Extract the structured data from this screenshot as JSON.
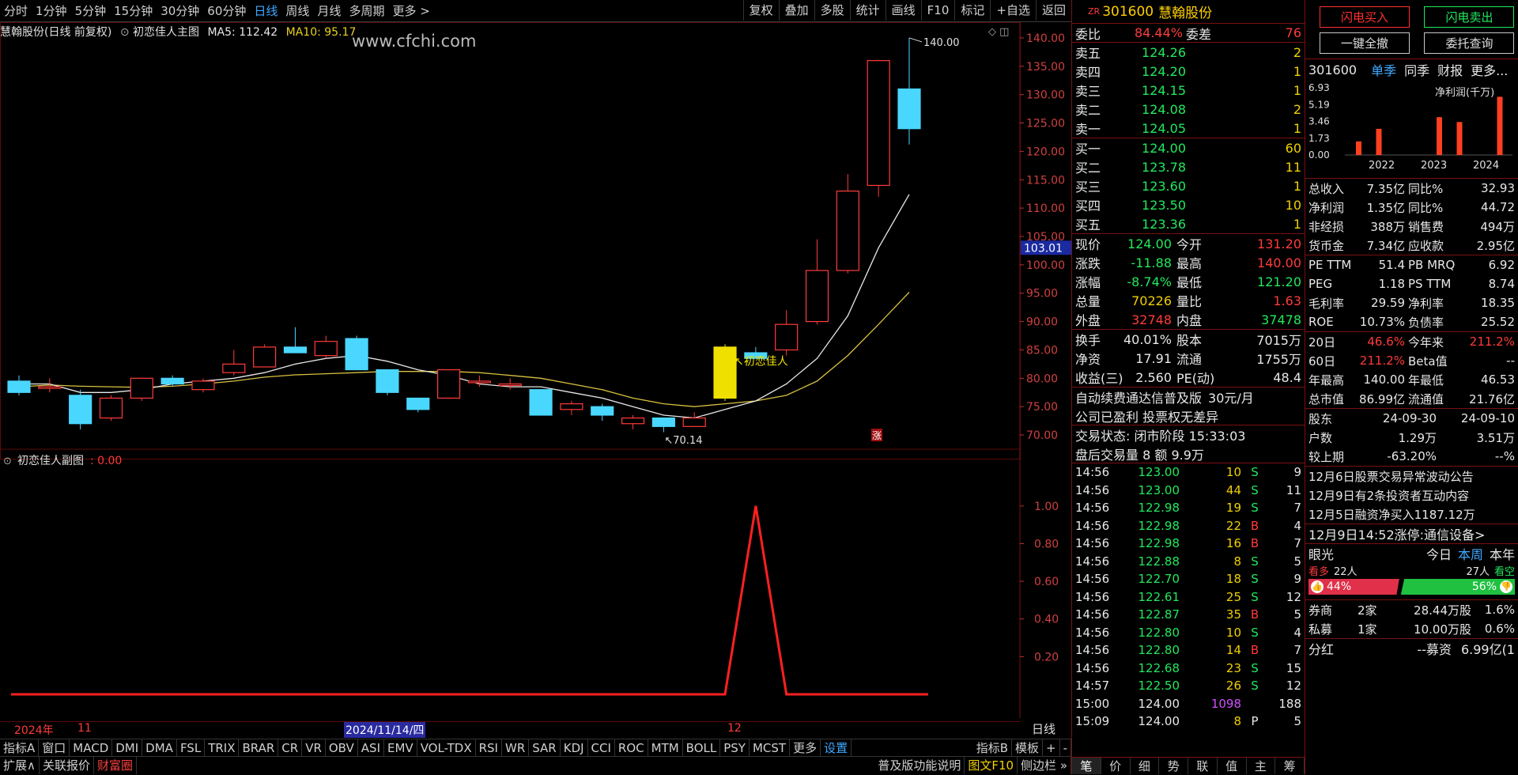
{
  "toolbar": {
    "periods": [
      "分时",
      "1分钟",
      "5分钟",
      "15分钟",
      "30分钟",
      "60分钟",
      "日线",
      "周线",
      "月线",
      "多周期",
      "更多 >"
    ],
    "active": "日线",
    "right": [
      "复权",
      "叠加",
      "多股",
      "统计",
      "画线",
      "F10",
      "标记",
      "+自选",
      "返回"
    ]
  },
  "chart_head": {
    "stock": "慧翰股份(日线 前复权)",
    "indicator": "初恋佳人主图",
    "ma5_label": "MA5: 112.42",
    "ma10_label": "MA10: 95.17"
  },
  "watermark": "www.cfchi.com",
  "main_axis": {
    "ticks": [
      "140.00",
      "135.00",
      "130.00",
      "125.00",
      "120.00",
      "115.00",
      "110.00",
      "105.00",
      "100.00",
      "95.00",
      "90.00",
      "85.00",
      "80.00",
      "75.00",
      "70.00"
    ],
    "current": "103.01"
  },
  "chart_data": [
    {
      "type": "candlestick",
      "ylim": [
        67.5,
        142.5
      ],
      "candles": [
        {
          "o": 79.5,
          "h": 80.5,
          "l": 77,
          "c": 77.5
        },
        {
          "o": 78.5,
          "h": 80,
          "l": 77.5,
          "c": 78.5
        },
        {
          "o": 77,
          "h": 78,
          "l": 71,
          "c": 72
        },
        {
          "o": 73,
          "h": 77,
          "l": 72.5,
          "c": 76.5
        },
        {
          "o": 76.5,
          "h": 80,
          "l": 76,
          "c": 80
        },
        {
          "o": 80,
          "h": 80.5,
          "l": 78.5,
          "c": 79
        },
        {
          "o": 78,
          "h": 80,
          "l": 77.5,
          "c": 79.5
        },
        {
          "o": 81,
          "h": 85,
          "l": 80.5,
          "c": 82.5
        },
        {
          "o": 82,
          "h": 86,
          "l": 82,
          "c": 85.5
        },
        {
          "o": 85.5,
          "h": 89,
          "l": 84.5,
          "c": 84.5
        },
        {
          "o": 84,
          "h": 87.5,
          "l": 83.5,
          "c": 86.5
        },
        {
          "o": 87,
          "h": 87.5,
          "l": 81.5,
          "c": 81.5
        },
        {
          "o": 81.5,
          "h": 81.5,
          "l": 77,
          "c": 77.5
        },
        {
          "o": 76.5,
          "h": 76.5,
          "l": 74,
          "c": 74.5
        },
        {
          "o": 76.5,
          "h": 81,
          "l": 76.5,
          "c": 81.5
        },
        {
          "o": 79.5,
          "h": 80.5,
          "l": 78.5,
          "c": 79.5
        },
        {
          "o": 79,
          "h": 80,
          "l": 78,
          "c": 79
        },
        {
          "o": 78,
          "h": 78,
          "l": 73.5,
          "c": 73.5
        },
        {
          "o": 74.5,
          "h": 76,
          "l": 73.5,
          "c": 75.5
        },
        {
          "o": 75,
          "h": 75.5,
          "l": 72.5,
          "c": 73.5
        },
        {
          "o": 72,
          "h": 73.5,
          "l": 71,
          "c": 73
        },
        {
          "o": 73,
          "h": 73,
          "l": 70.5,
          "c": 71.5
        },
        {
          "o": 71.5,
          "h": 74,
          "l": 71.5,
          "c": 73
        },
        {
          "o": 76.5,
          "h": 86,
          "l": 76,
          "c": 85.5
        },
        {
          "o": 84.5,
          "h": 85.5,
          "l": 84,
          "c": 83.5
        },
        {
          "o": 85,
          "h": 92,
          "l": 84,
          "c": 89.5
        },
        {
          "o": 90,
          "h": 104.5,
          "l": 89.5,
          "c": 99
        },
        {
          "o": 99,
          "h": 116,
          "l": 98.5,
          "c": 113
        },
        {
          "o": 114,
          "h": 136,
          "l": 112,
          "c": 136
        },
        {
          "o": 131,
          "h": 140,
          "l": 121.2,
          "c": 124
        }
      ],
      "ma5": [
        79,
        79,
        77.5,
        77.5,
        78,
        79,
        79.5,
        80,
        81,
        82.5,
        83.5,
        84,
        83,
        81.5,
        80.5,
        79,
        78.5,
        78.5,
        77.5,
        76.5,
        75,
        73.5,
        73,
        74.5,
        76,
        79,
        83.5,
        91,
        103,
        112.42
      ],
      "ma10": [
        78.5,
        78.8,
        78.6,
        78.5,
        78.4,
        78.6,
        79,
        79.5,
        80.2,
        80.6,
        80.8,
        81,
        81.2,
        81.2,
        81.2,
        81,
        80.5,
        80,
        79,
        78,
        76.5,
        75.5,
        75,
        75.5,
        76,
        77,
        79.5,
        84,
        89.5,
        95.17
      ],
      "annotations": {
        "high": "140.00",
        "low": "70.14",
        "signal": "初恋佳人",
        "marker": "涨"
      }
    },
    {
      "type": "line",
      "title": "初恋佳人副图",
      "value_label": ": 0.00",
      "ylim": [
        0,
        1.1
      ],
      "values": [
        0,
        0,
        0,
        0,
        0,
        0,
        0,
        0,
        0,
        0,
        0,
        0,
        0,
        0,
        0,
        0,
        0,
        0,
        0,
        0,
        0,
        0,
        0,
        0,
        1,
        0,
        0,
        0,
        0,
        0
      ]
    }
  ],
  "sub_axis": {
    "ticks": [
      "1.00",
      "0.80",
      "0.60",
      "0.40",
      "0.20"
    ]
  },
  "date_axis": {
    "year": "2024年",
    "m11": "11",
    "selected": "2024/11/14/四",
    "m12": "12",
    "period": "日线"
  },
  "indicator_bar": [
    "指标A",
    "窗口",
    "MACD",
    "DMI",
    "DMA",
    "FSL",
    "TRIX",
    "BRAR",
    "CR",
    "VR",
    "OBV",
    "ASI",
    "EMV",
    "VOL-TDX",
    "RSI",
    "WR",
    "SAR",
    "KDJ",
    "CCI",
    "ROC",
    "MTM",
    "BOLL",
    "PSY",
    "MCST",
    "更多",
    "设置"
  ],
  "indicator_right": [
    "指标B",
    "模板",
    "+",
    "-"
  ],
  "bottom_bar": {
    "expand": "扩展∧",
    "linked": "关联报价",
    "wealth": "财富圈",
    "notice": "普及版功能说明",
    "f10": "图文F10",
    "side": "侧边栏 »"
  },
  "quote": {
    "code": "301600",
    "name": "慧翰股份",
    "badge": "ZR",
    "wei_bi_label": "委比",
    "wei_bi": "84.44%",
    "wei_cha_label": "委差",
    "wei_cha": "76",
    "sells": [
      {
        "label": "卖五",
        "price": "124.26",
        "vol": "2"
      },
      {
        "label": "卖四",
        "price": "124.20",
        "vol": "1"
      },
      {
        "label": "卖三",
        "price": "124.15",
        "vol": "1"
      },
      {
        "label": "卖二",
        "price": "124.08",
        "vol": "2"
      },
      {
        "label": "卖一",
        "price": "124.05",
        "vol": "1"
      }
    ],
    "buys": [
      {
        "label": "买一",
        "price": "124.00",
        "vol": "60"
      },
      {
        "label": "买二",
        "price": "123.78",
        "vol": "11"
      },
      {
        "label": "买三",
        "price": "123.60",
        "vol": "1"
      },
      {
        "label": "买四",
        "price": "123.50",
        "vol": "10"
      },
      {
        "label": "买五",
        "price": "123.36",
        "vol": "1"
      }
    ],
    "stats": [
      {
        "l1": "现价",
        "v1": "124.00",
        "c1": "down",
        "l2": "今开",
        "v2": "131.20",
        "c2": "up"
      },
      {
        "l1": "涨跌",
        "v1": "-11.88",
        "c1": "down",
        "l2": "最高",
        "v2": "140.00",
        "c2": "up"
      },
      {
        "l1": "涨幅",
        "v1": "-8.74%",
        "c1": "down",
        "l2": "最低",
        "v2": "121.20",
        "c2": "down"
      },
      {
        "l1": "总量",
        "v1": "70226",
        "c1": "yel",
        "l2": "量比",
        "v2": "1.63",
        "c2": "up"
      },
      {
        "l1": "外盘",
        "v1": "32748",
        "c1": "up",
        "l2": "内盘",
        "v2": "37478",
        "c2": "down"
      }
    ],
    "stats2": [
      {
        "l1": "换手",
        "v1": "40.01%",
        "l2": "股本",
        "v2": "7015万"
      },
      {
        "l1": "净资",
        "v1": "17.91",
        "l2": "流通",
        "v2": "1755万"
      },
      {
        "l1": "收益(三)",
        "v1": "2.560",
        "l2": "PE(动)",
        "v2": "48.4"
      }
    ],
    "ad1": "自动续费通达信普及版",
    "ad1_price": "30元/月",
    "ad2": "公司已盈利 投票权无差异",
    "status": "交易状态: 闭市阶段 15:33:03",
    "after": "盘后交易量 8 额 9.9万",
    "ticks": [
      {
        "t": "14:56",
        "p": "123.00",
        "v": "10",
        "s": "S",
        "n": "9"
      },
      {
        "t": "14:56",
        "p": "123.00",
        "v": "44",
        "s": "S",
        "n": "11"
      },
      {
        "t": "14:56",
        "p": "122.98",
        "v": "19",
        "s": "S",
        "n": "7"
      },
      {
        "t": "14:56",
        "p": "122.98",
        "v": "22",
        "s": "B",
        "n": "4"
      },
      {
        "t": "14:56",
        "p": "122.98",
        "v": "16",
        "s": "B",
        "n": "7"
      },
      {
        "t": "14:56",
        "p": "122.88",
        "v": "8",
        "s": "S",
        "n": "5"
      },
      {
        "t": "14:56",
        "p": "122.70",
        "v": "18",
        "s": "S",
        "n": "9"
      },
      {
        "t": "14:56",
        "p": "122.61",
        "v": "25",
        "s": "S",
        "n": "12"
      },
      {
        "t": "14:56",
        "p": "122.87",
        "v": "35",
        "s": "B",
        "n": "5"
      },
      {
        "t": "14:56",
        "p": "122.80",
        "v": "10",
        "s": "S",
        "n": "4"
      },
      {
        "t": "14:56",
        "p": "122.80",
        "v": "14",
        "s": "B",
        "n": "7"
      },
      {
        "t": "14:56",
        "p": "122.68",
        "v": "23",
        "s": "S",
        "n": "15"
      },
      {
        "t": "14:57",
        "p": "122.50",
        "v": "26",
        "s": "S",
        "n": "12"
      },
      {
        "t": "15:00",
        "p": "124.00",
        "v": "1098",
        "s": "",
        "n": "188"
      },
      {
        "t": "15:09",
        "p": "124.00",
        "v": "8",
        "s": "P",
        "n": "5"
      }
    ],
    "tabs": [
      "笔",
      "价",
      "细",
      "势",
      "联",
      "值",
      "主",
      "筹"
    ]
  },
  "right": {
    "btn_buy": "闪电买入",
    "btn_sell": "闪电卖出",
    "btn_cancel": "一键全撤",
    "btn_query": "委托查询",
    "code": "301600",
    "tabs": [
      "单季",
      "同季",
      "财报",
      "更多..."
    ],
    "fin_chart": {
      "type": "bar",
      "title": "净利润(千万)",
      "yticks": [
        "6.93",
        "5.19",
        "3.46",
        "1.73",
        "0.00"
      ],
      "ylim": [
        0,
        6.93
      ],
      "years": [
        "2022",
        "2023",
        "2024"
      ],
      "values": [
        1.4,
        2.7,
        0,
        0,
        3.9,
        3.4,
        0,
        6.0
      ]
    },
    "fund": [
      {
        "l1": "总收入",
        "v1": "7.35亿",
        "l2": "同比%",
        "v2": "32.93"
      },
      {
        "l1": "净利润",
        "v1": "1.35亿",
        "l2": "同比%",
        "v2": "44.72"
      },
      {
        "l1": "非经损",
        "v1": "388万",
        "l2": "销售费",
        "v2": "494万"
      },
      {
        "l1": "货币金",
        "v1": "7.34亿",
        "l2": "应收款",
        "v2": "2.95亿"
      }
    ],
    "val": [
      {
        "l1": "PE TTM",
        "v1": "51.4",
        "l2": "PB MRQ",
        "v2": "6.92"
      },
      {
        "l1": "PEG",
        "v1": "1.18",
        "l2": "PS TTM",
        "v2": "8.74"
      },
      {
        "l1": "毛利率",
        "v1": "29.59",
        "l2": "净利率",
        "v2": "18.35"
      },
      {
        "l1": "ROE",
        "v1": "10.73%",
        "l2": "负债率",
        "v2": "25.52"
      }
    ],
    "perf": [
      {
        "l1": "20日",
        "v1": "46.6%",
        "c1": "up",
        "l2": "今年来",
        "v2": "211.2%",
        "c2": "up"
      },
      {
        "l1": "60日",
        "v1": "211.2%",
        "c1": "up",
        "l2": "Beta值",
        "v2": "--",
        "c2": "wht"
      },
      {
        "l1": "年最高",
        "v1": "140.00",
        "c1": "wht",
        "l2": "年最低",
        "v2": "46.53",
        "c2": "wht"
      },
      {
        "l1": "总市值",
        "v1": "86.99亿",
        "c1": "wht",
        "l2": "流通值",
        "v2": "21.76亿",
        "c2": "wht"
      }
    ],
    "holders": [
      {
        "l1": "股东",
        "v1": "24-09-30",
        "v2": "24-09-10"
      },
      {
        "l1": "户数",
        "v1": "1.29万",
        "v2": "3.51万"
      },
      {
        "l1": "较上期",
        "v1": "-63.20%",
        "v2": "--%"
      }
    ],
    "news": [
      "12月6日股票交易异常波动公告",
      "12月9日有2条投资者互动内容",
      "12月5日融资净买入1187.12万"
    ],
    "limit_note": "12月9日14:52涨停:通信设备>",
    "eye": "眼光",
    "eye_tabs": [
      "今日",
      "本周",
      "本年"
    ],
    "bull_label": "看多",
    "bull_count": "22人",
    "bear_count": "27人",
    "bear_label": "看空",
    "bull_pct": "44%",
    "bear_pct": "56%",
    "bull_fraction": 0.44,
    "inst": [
      {
        "l1": "券商",
        "v1": "2家",
        "v2": "28.44万股",
        "v3": "1.6%"
      },
      {
        "l1": "私募",
        "v1": "1家",
        "v2": "10.00万股",
        "v3": "0.6%"
      }
    ],
    "div_label": "分红",
    "div_raise": "--募资",
    "div_val": "6.99亿(1"
  },
  "colors": {
    "up": "#ff3b3b",
    "down": "#22e85c",
    "cyan": "#4ad7ff",
    "ma5": "#e8e8e8",
    "ma10": "#d8c040",
    "signal": "#f0e000",
    "border": "#7a1010"
  }
}
